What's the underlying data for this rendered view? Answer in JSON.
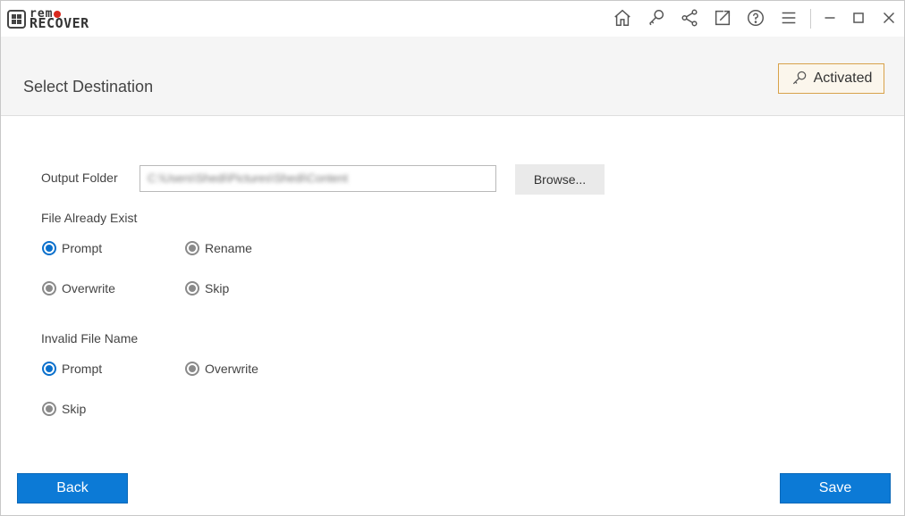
{
  "app": {
    "logo_top": "rem",
    "logo_top_suffix": "",
    "logo_bottom": "RECOVER"
  },
  "titlebar": {
    "icons": [
      "home-icon",
      "key-icon",
      "share-icon",
      "export-icon",
      "help-icon",
      "menu-icon",
      "minimize-icon",
      "maximize-icon",
      "close-icon"
    ]
  },
  "header": {
    "title": "Select Destination",
    "activated_label": "Activated"
  },
  "form": {
    "output_folder_label": "Output Folder",
    "output_folder_value": "C:\\Users\\Shedi\\Pictures\\Shedi\\Content",
    "browse_label": "Browse...",
    "file_exists_label": "File Already Exist",
    "file_exists_options": {
      "prompt": "Prompt",
      "rename": "Rename",
      "overwrite": "Overwrite",
      "skip": "Skip"
    },
    "file_exists_selected": "Prompt",
    "invalid_name_label": "Invalid File Name",
    "invalid_name_options": {
      "prompt": "Prompt",
      "overwrite": "Overwrite",
      "skip": "Skip"
    },
    "invalid_name_selected": "Prompt"
  },
  "footer": {
    "back_label": "Back",
    "save_label": "Save"
  },
  "colors": {
    "accent": "#0c7ad6",
    "activated_border": "#d8a24a",
    "logo_dot": "#d9281d"
  }
}
